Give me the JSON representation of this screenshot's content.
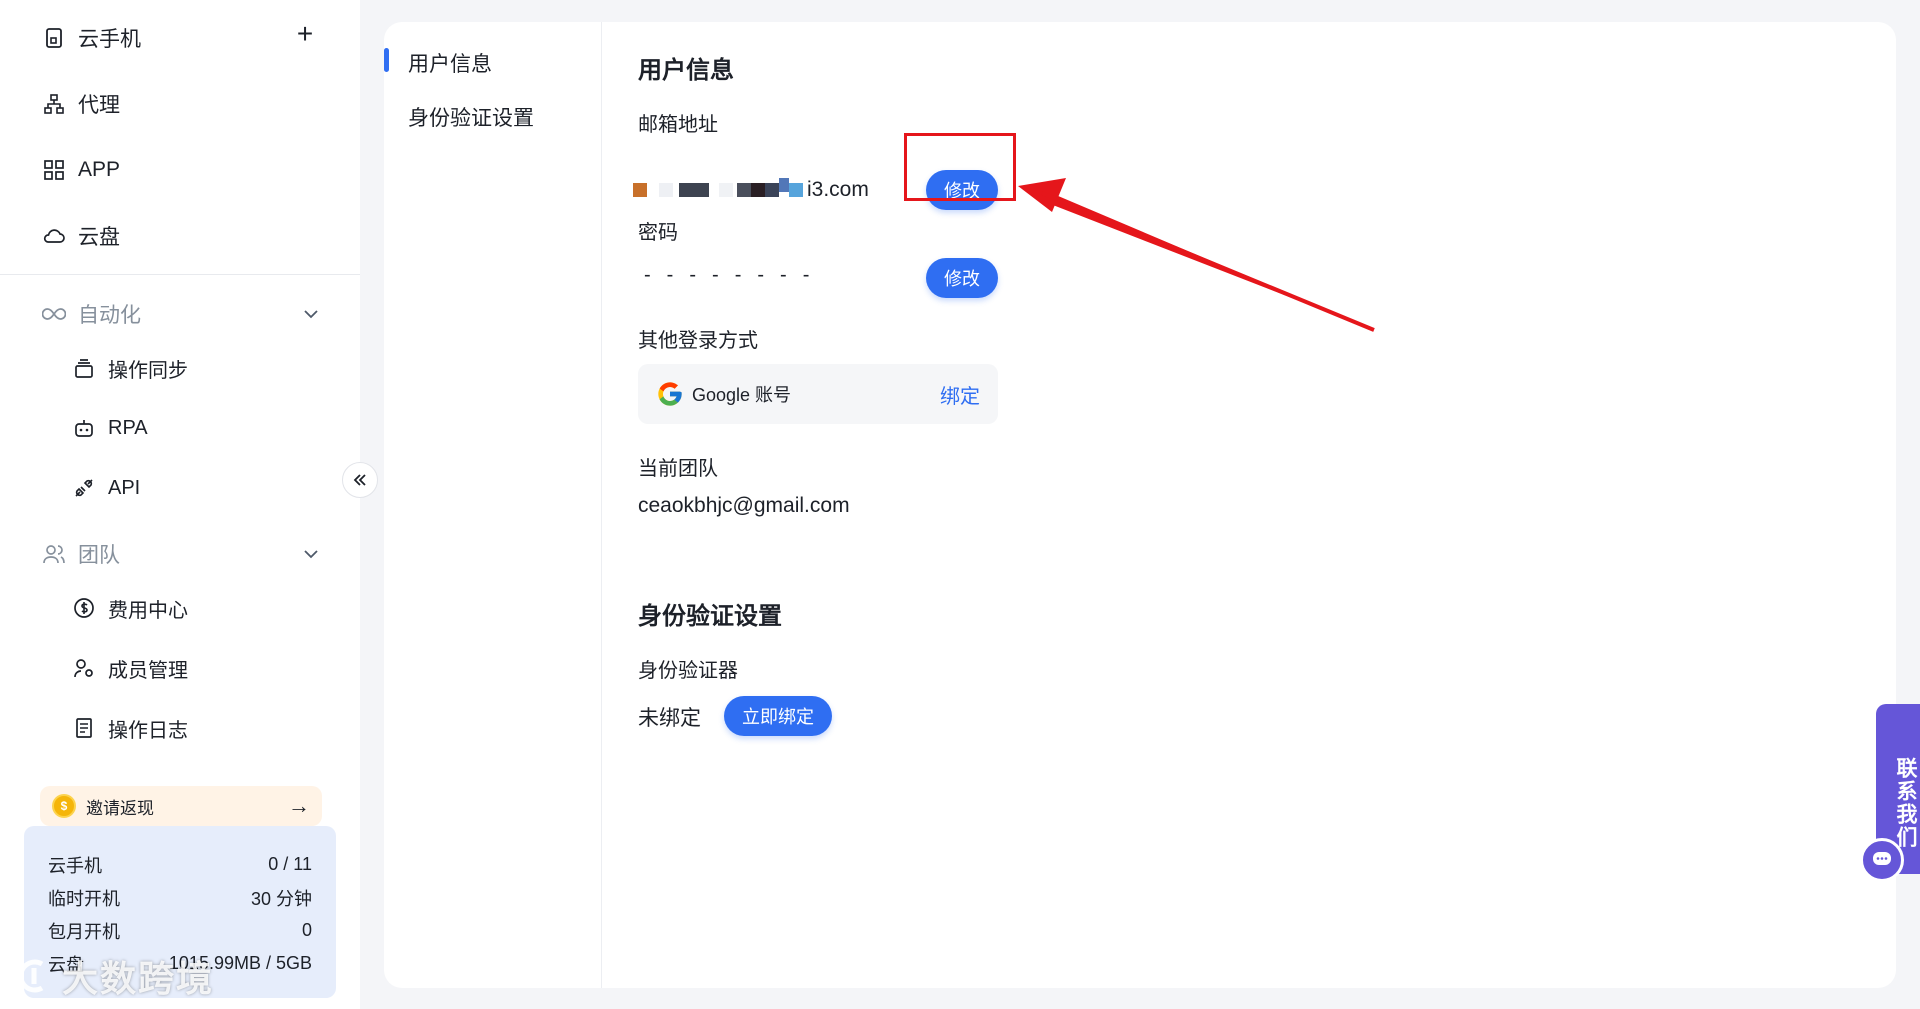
{
  "sidebar": {
    "top_items": [
      {
        "label": "云手机",
        "icon": "phone-icon"
      },
      {
        "label": "代理",
        "icon": "network-icon"
      },
      {
        "label": "APP",
        "icon": "grid-icon"
      },
      {
        "label": "云盘",
        "icon": "cloud-icon"
      }
    ],
    "add_icon": "plus-icon",
    "groups": [
      {
        "title": "自动化",
        "icon": "infinity-icon",
        "items": [
          {
            "label": "操作同步",
            "icon": "layers-icon"
          },
          {
            "label": "RPA",
            "icon": "robot-icon"
          },
          {
            "label": "API",
            "icon": "plug-icon"
          }
        ]
      },
      {
        "title": "团队",
        "icon": "users-icon",
        "items": [
          {
            "label": "费用中心",
            "icon": "dollar-icon"
          },
          {
            "label": "成员管理",
            "icon": "user-gear-icon"
          },
          {
            "label": "操作日志",
            "icon": "log-icon"
          }
        ]
      }
    ],
    "invite": {
      "label": "邀请返现",
      "arrow": "→"
    },
    "quota": [
      {
        "label": "云手机",
        "value": "0 / 11"
      },
      {
        "label": "临时开机",
        "value": "30 分钟"
      },
      {
        "label": "包月开机",
        "value": "0"
      },
      {
        "label": "云盘",
        "value": "1015.99MB / 5GB"
      }
    ],
    "watermark": "大数跨境"
  },
  "subnav": {
    "items": [
      "用户信息",
      "身份验证设置"
    ],
    "active": 0
  },
  "user_info": {
    "title": "用户信息",
    "email_label": "邮箱地址",
    "email_visible_suffix": "i3.com",
    "modify_label": "修改",
    "password_label": "密码",
    "password_mask": [
      "-",
      "-",
      "-",
      "-",
      "-",
      "-",
      "-",
      "-"
    ],
    "other_login_label": "其他登录方式",
    "google_label": "Google 账号",
    "bind_label": "绑定",
    "team_label": "当前团队",
    "team_value": "ceaokbhjc@gmail.com"
  },
  "auth_settings": {
    "title": "身份验证设置",
    "authenticator_label": "身份验证器",
    "status": "未绑定",
    "bind_now_label": "立即绑定"
  },
  "contact": {
    "label": "联系我们",
    "icon": "chat-icon"
  },
  "colors": {
    "primary": "#2f6ef2",
    "annotation_red": "#e5161b",
    "contact_purple": "#6556d8"
  }
}
